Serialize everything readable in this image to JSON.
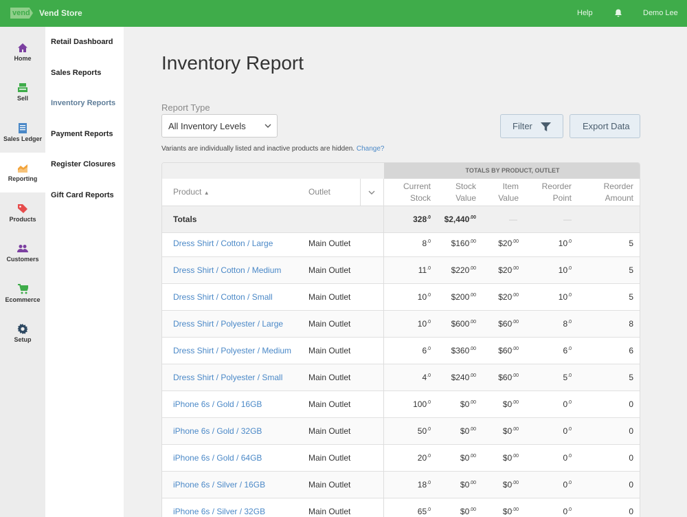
{
  "topbar": {
    "logo": "vend",
    "store": "Vend Store",
    "help": "Help",
    "user": "Demo Lee",
    "bell_icon": "bell-icon",
    "accent": "#3fac4a"
  },
  "icon_nav": [
    {
      "label": "Home",
      "icon": "home-icon"
    },
    {
      "label": "Sell",
      "icon": "register-icon"
    },
    {
      "label": "Sales Ledger",
      "icon": "ledger-icon"
    },
    {
      "label": "Reporting",
      "icon": "chart-icon"
    },
    {
      "label": "Products",
      "icon": "tag-icon"
    },
    {
      "label": "Customers",
      "icon": "people-icon"
    },
    {
      "label": "Ecommerce",
      "icon": "cart-icon"
    },
    {
      "label": "Setup",
      "icon": "gear-icon"
    }
  ],
  "sub_nav": [
    "Retail Dashboard",
    "Sales Reports",
    "Inventory Reports",
    "Payment Reports",
    "Register Closures",
    "Gift Card Reports"
  ],
  "page": {
    "title": "Inventory Report",
    "report_type_label": "Report Type",
    "report_type_value": "All Inventory Levels",
    "filter_label": "Filter",
    "export_label": "Export Data",
    "note": "Variants are individually listed and inactive products are hidden.",
    "note_link": "Change?"
  },
  "table": {
    "band_label": "TOTALS BY PRODUCT, OUTLET",
    "headers": {
      "product": "Product",
      "sort_icon": "▲",
      "outlet": "Outlet",
      "current_stock": [
        "Current",
        "Stock"
      ],
      "stock_value": [
        "Stock",
        "Value"
      ],
      "item_value": [
        "Item",
        "Value"
      ],
      "reorder_point": [
        "Reorder",
        "Point"
      ],
      "reorder_amount": [
        "Reorder",
        "Amount"
      ]
    },
    "totals": {
      "label": "Totals",
      "current_stock": "328",
      "current_stock_dec": ".0",
      "stock_value": "$2,440",
      "stock_value_dec": ".00",
      "item_value": "—",
      "reorder_point": "—"
    },
    "rows": [
      {
        "product": "Dress Shirt / Cotton / Large",
        "outlet": "Main Outlet",
        "stock": "8",
        "stock_value": "$160",
        "item_value": "$20",
        "reorder_point": "10",
        "reorder_amount": "5"
      },
      {
        "product": "Dress Shirt / Cotton / Medium",
        "outlet": "Main Outlet",
        "stock": "11",
        "stock_value": "$220",
        "item_value": "$20",
        "reorder_point": "10",
        "reorder_amount": "5"
      },
      {
        "product": "Dress Shirt / Cotton / Small",
        "outlet": "Main Outlet",
        "stock": "10",
        "stock_value": "$200",
        "item_value": "$20",
        "reorder_point": "10",
        "reorder_amount": "5"
      },
      {
        "product": "Dress Shirt / Polyester / Large",
        "outlet": "Main Outlet",
        "stock": "10",
        "stock_value": "$600",
        "item_value": "$60",
        "reorder_point": "8",
        "reorder_amount": "8"
      },
      {
        "product": "Dress Shirt / Polyester / Medium",
        "outlet": "Main Outlet",
        "stock": "6",
        "stock_value": "$360",
        "item_value": "$60",
        "reorder_point": "6",
        "reorder_amount": "6"
      },
      {
        "product": "Dress Shirt / Polyester / Small",
        "outlet": "Main Outlet",
        "stock": "4",
        "stock_value": "$240",
        "item_value": "$60",
        "reorder_point": "5",
        "reorder_amount": "5"
      },
      {
        "product": "iPhone 6s / Gold / 16GB",
        "outlet": "Main Outlet",
        "stock": "100",
        "stock_value": "$0",
        "item_value": "$0",
        "reorder_point": "0",
        "reorder_amount": "0"
      },
      {
        "product": "iPhone 6s / Gold / 32GB",
        "outlet": "Main Outlet",
        "stock": "50",
        "stock_value": "$0",
        "item_value": "$0",
        "reorder_point": "0",
        "reorder_amount": "0"
      },
      {
        "product": "iPhone 6s / Gold / 64GB",
        "outlet": "Main Outlet",
        "stock": "20",
        "stock_value": "$0",
        "item_value": "$0",
        "reorder_point": "0",
        "reorder_amount": "0"
      },
      {
        "product": "iPhone 6s / Silver / 16GB",
        "outlet": "Main Outlet",
        "stock": "18",
        "stock_value": "$0",
        "item_value": "$0",
        "reorder_point": "0",
        "reorder_amount": "0"
      },
      {
        "product": "iPhone 6s / Silver / 32GB",
        "outlet": "Main Outlet",
        "stock": "65",
        "stock_value": "$0",
        "item_value": "$0",
        "reorder_point": "0",
        "reorder_amount": "0"
      }
    ],
    "dec1": ".0",
    "dec2": ".00"
  }
}
